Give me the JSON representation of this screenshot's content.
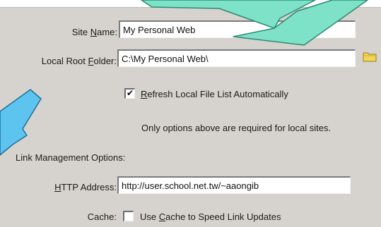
{
  "site_name": {
    "label": "Site Name:",
    "value": "My Personal Web"
  },
  "local_root_folder": {
    "label": "Local Root Folder:",
    "value": "C:\\My Personal Web\\",
    "icon": "folder-icon"
  },
  "refresh_option": {
    "label": "Refresh Local File List Automatically",
    "checked": true
  },
  "note": "Only options above are required for local sites.",
  "link_management": {
    "heading": "Link Management Options:"
  },
  "http_address": {
    "label": "HTTP Address:",
    "value": "http://user.school.net.tw/~aaongib"
  },
  "cache": {
    "label": "Cache:",
    "option": "Use Cache to Speed Link Updates",
    "checked": false
  },
  "colors": {
    "dialog_bg": "#d6d3ce",
    "arrow_teal": "#7ee2c8",
    "arrow_blue": "#5cc4ef"
  }
}
